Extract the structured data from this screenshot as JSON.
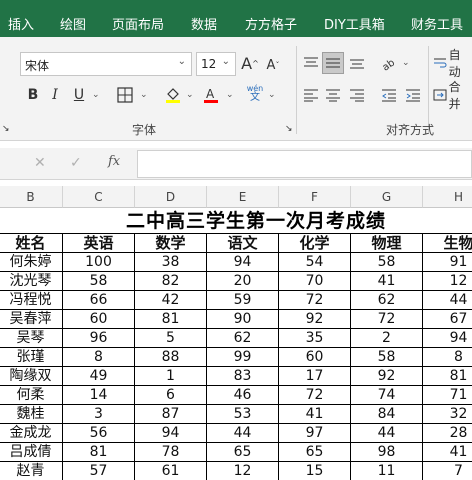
{
  "ribbon_tabs": [
    "插入",
    "绘图",
    "页面布局",
    "数据",
    "方方格子",
    "DIY工具箱",
    "财务工具"
  ],
  "font": {
    "name": "宋体",
    "size": "12",
    "grow_label": "A",
    "shrink_label": "A",
    "bold": "B",
    "italic": "I",
    "underline": "U",
    "pinyin_top": "wén",
    "pinyin_bottom": "文",
    "group_label": "字体"
  },
  "alignment": {
    "wrap_label": "自动",
    "merge_label": "合并",
    "group_label": "对齐方式"
  },
  "formula_bar": {
    "fx_label": "fx",
    "cancel": "✕",
    "confirm": "✓"
  },
  "columns": [
    "B",
    "C",
    "D",
    "E",
    "F",
    "G",
    "H"
  ],
  "sheet": {
    "title": "二中高三学生第一次月考成绩",
    "headers": [
      "姓名",
      "英语",
      "数学",
      "语文",
      "化学",
      "物理",
      "生物"
    ],
    "rows": [
      [
        "何朱婷",
        "100",
        "38",
        "94",
        "54",
        "58",
        "91"
      ],
      [
        "沈光琴",
        "58",
        "82",
        "20",
        "70",
        "41",
        "12"
      ],
      [
        "冯程悦",
        "66",
        "42",
        "59",
        "72",
        "62",
        "44"
      ],
      [
        "吴春萍",
        "60",
        "81",
        "90",
        "92",
        "72",
        "67"
      ],
      [
        "吴琴",
        "96",
        "5",
        "62",
        "35",
        "2",
        "94"
      ],
      [
        "张瑾",
        "8",
        "88",
        "99",
        "60",
        "58",
        "8"
      ],
      [
        "陶缘双",
        "49",
        "1",
        "83",
        "17",
        "92",
        "81"
      ],
      [
        "何柔",
        "14",
        "6",
        "46",
        "72",
        "74",
        "71"
      ],
      [
        "魏桂",
        "3",
        "87",
        "53",
        "41",
        "84",
        "32"
      ],
      [
        "金成龙",
        "56",
        "94",
        "44",
        "97",
        "44",
        "28"
      ],
      [
        "吕成倩",
        "81",
        "78",
        "65",
        "65",
        "98",
        "41"
      ],
      [
        "赵青",
        "57",
        "61",
        "12",
        "15",
        "11",
        "7"
      ]
    ]
  },
  "colors": {
    "ribbon_green": "#217346",
    "ribbon_bg": "#f3f3f3",
    "highlight_yellow": "#ffff00",
    "font_red": "#ff0000"
  }
}
